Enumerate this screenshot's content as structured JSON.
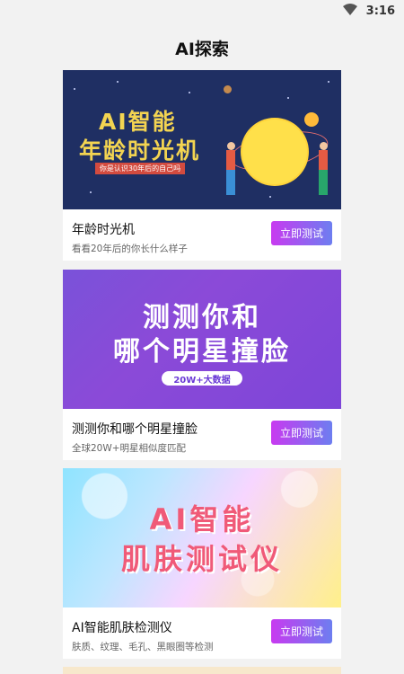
{
  "status_bar": {
    "time": "3:16",
    "wifi_icon": "wifi-icon"
  },
  "header": {
    "title": "AI探索"
  },
  "cards": [
    {
      "banner": {
        "line1": "AI智能",
        "line2": "年龄时光机",
        "tag": "你是认识30年后的自己吗"
      },
      "title": "年龄时光机",
      "subtitle": "看看20年后的你长什么样子",
      "button": "立即测试"
    },
    {
      "banner": {
        "line1": "测测你和",
        "line2": "哪个明星撞脸",
        "tag": "20W+大数据"
      },
      "title": "测测你和哪个明星撞脸",
      "subtitle": "全球20W+明星相似度匹配",
      "button": "立即测试"
    },
    {
      "banner": {
        "line1": "AI智能",
        "line2": "肌肤测试仪"
      },
      "title": "AI智能肌肤检测仪",
      "subtitle": "肤质、纹理、毛孔、黑眼圈等检测",
      "button": "立即测试"
    }
  ],
  "colors": {
    "accent_start": "#c83af0",
    "accent_end": "#6d7ef0"
  }
}
